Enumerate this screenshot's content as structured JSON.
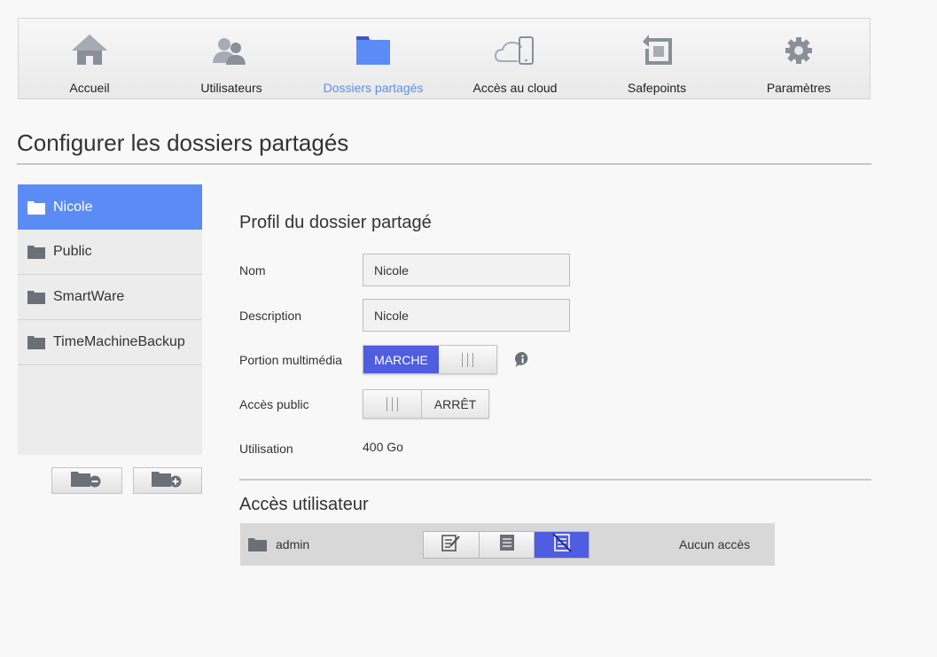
{
  "nav": {
    "items": [
      {
        "label": "Accueil",
        "icon": "home-icon"
      },
      {
        "label": "Utilisateurs",
        "icon": "users-icon"
      },
      {
        "label": "Dossiers partagés",
        "icon": "shared-folder-icon",
        "active": true
      },
      {
        "label": "Accès au cloud",
        "icon": "cloud-device-icon"
      },
      {
        "label": "Safepoints",
        "icon": "safepoint-icon"
      },
      {
        "label": "Paramètres",
        "icon": "gear-icon"
      }
    ]
  },
  "page": {
    "title": "Configurer les dossiers partagés"
  },
  "folders": {
    "items": [
      {
        "label": "Nicole",
        "selected": true
      },
      {
        "label": "Public"
      },
      {
        "label": "SmartWare"
      },
      {
        "label": "TimeMachineBackup"
      }
    ],
    "remove_button": "folder-remove-icon",
    "add_button": "folder-add-icon"
  },
  "profile": {
    "title": "Profil du dossier partagé",
    "name_label": "Nom",
    "name_value": "Nicole",
    "description_label": "Description",
    "description_value": "Nicole",
    "media_label": "Portion multimédia",
    "media_state": "MARCHE",
    "public_label": "Accès public",
    "public_state": "ARRÊT",
    "usage_label": "Utilisation",
    "usage_value": "400 Go"
  },
  "user_access": {
    "title": "Accès utilisateur",
    "users": [
      {
        "name": "admin",
        "access": "Aucun accès",
        "selected_permission": "no-access"
      }
    ]
  },
  "colors": {
    "accent": "#4f5de0",
    "selection": "#5b8cf6",
    "nav_active_text": "#5b8def"
  }
}
